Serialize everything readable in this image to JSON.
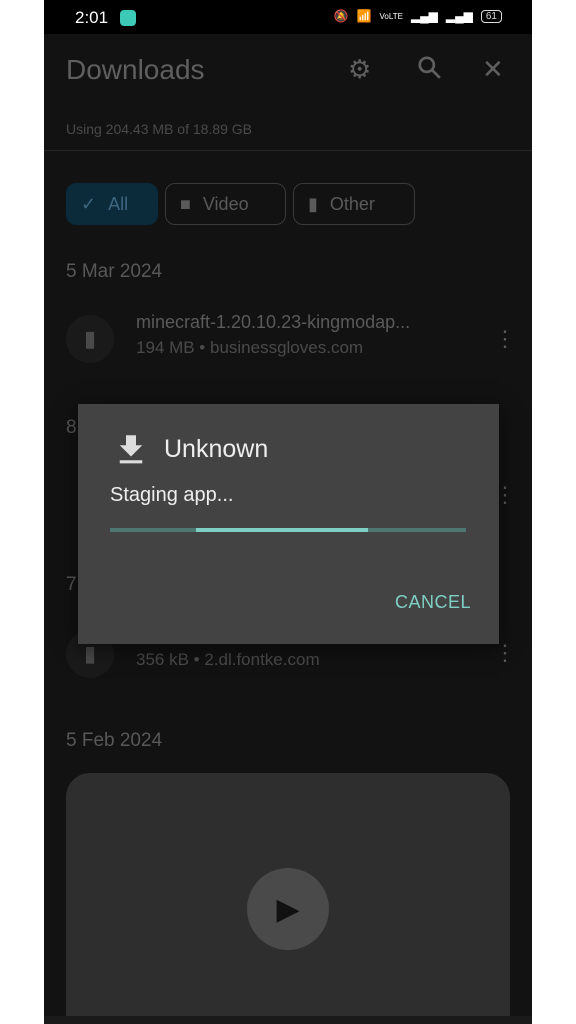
{
  "status_bar": {
    "time": "2:01",
    "battery": "61",
    "network": "VoLTE"
  },
  "header": {
    "title": "Downloads",
    "icons": [
      "settings-icon",
      "search-icon",
      "close-icon"
    ]
  },
  "storage": {
    "usage_text": "Using 204.43 MB of 18.89 GB"
  },
  "filters": [
    {
      "label": "All",
      "icon": "check-icon",
      "selected": true
    },
    {
      "label": "Video",
      "icon": "videocam-icon",
      "selected": false
    },
    {
      "label": "Other",
      "icon": "file-icon",
      "selected": false
    }
  ],
  "sections": [
    {
      "date": "5 Mar 2024",
      "items": [
        {
          "name": "minecraft-1.20.10.23-kingmodap...",
          "meta": "194 MB • businessgloves.com"
        }
      ]
    },
    {
      "date": "8",
      "items": []
    },
    {
      "date": "7",
      "items": [
        {
          "name": "",
          "meta": "356 kB • 2.dl.fontke.com"
        }
      ]
    },
    {
      "date": "5 Feb 2024",
      "items": []
    }
  ],
  "dialog": {
    "title": "Unknown",
    "message": "Staging app...",
    "progress": "indeterminate",
    "cancel_label": "CANCEL"
  },
  "colors": {
    "accent": "#7fd0c4",
    "dialog_bg": "#434343",
    "background": "#121212"
  }
}
